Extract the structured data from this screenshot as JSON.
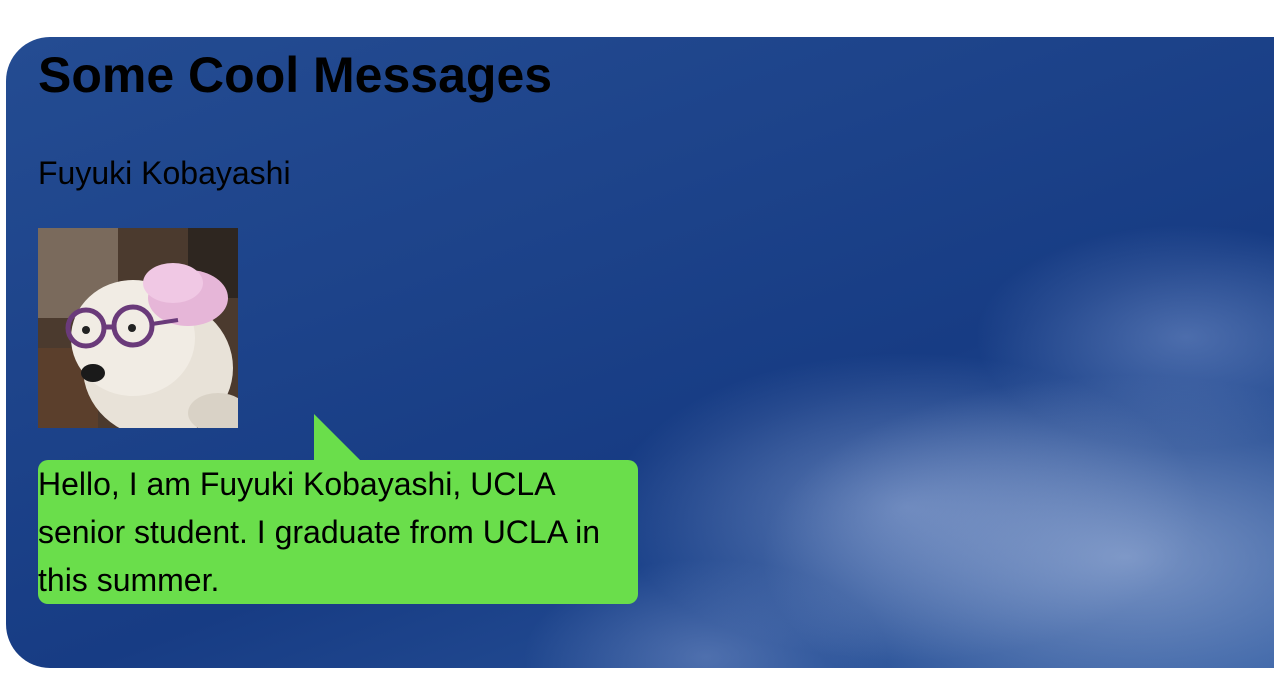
{
  "page": {
    "title": "Some Cool Messages",
    "author": "Fuyuki Kobayashi",
    "avatar_alt": "dog-wearing-glasses-photo",
    "message": "Hello, I am Fuyuki Kobayashi, UCLA senior student. I graduate from UCLA in this summer."
  },
  "colors": {
    "bubble": "#6ade4b",
    "sky": "#1d438a",
    "text": "#000000"
  }
}
